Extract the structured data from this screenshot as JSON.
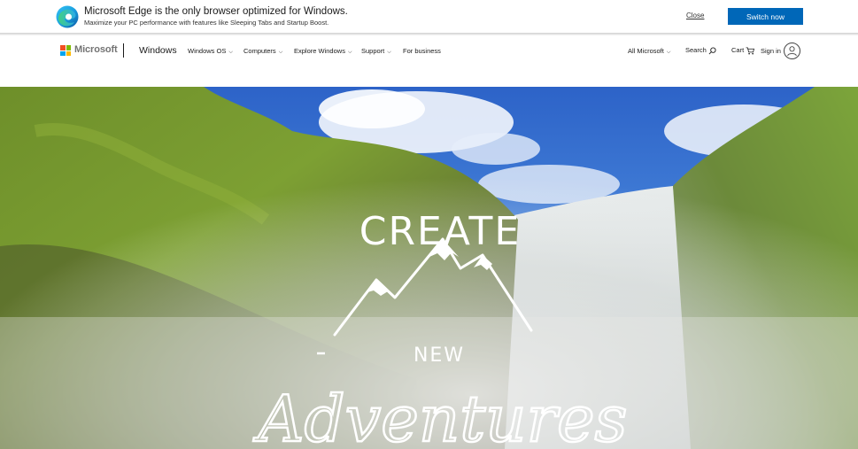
{
  "edge_banner": {
    "title": "Microsoft Edge is the only browser optimized for Windows.",
    "subtitle": "Maximize your PC performance with features like Sleeping Tabs and Startup Boost.",
    "close_label": "Close",
    "switch_label": "Switch now"
  },
  "nav": {
    "brand": "Microsoft",
    "product": "Windows",
    "items": [
      {
        "label": "Windows OS",
        "has_dropdown": true
      },
      {
        "label": "Computers",
        "has_dropdown": true
      },
      {
        "label": "Explore Windows",
        "has_dropdown": true
      },
      {
        "label": "Support",
        "has_dropdown": true
      },
      {
        "label": "For business",
        "has_dropdown": false
      }
    ],
    "all_microsoft": "All Microsoft",
    "search": "Search",
    "cart": "Cart",
    "sign_in": "Sign in"
  },
  "hero": {
    "line1": "CREATE",
    "line2": "NEW",
    "line3": "Adventures"
  },
  "colors": {
    "accent": "#0067b8",
    "ms_red": "#f25022",
    "ms_green": "#7fba00",
    "ms_blue": "#00a4ef",
    "ms_yellow": "#ffb900"
  }
}
